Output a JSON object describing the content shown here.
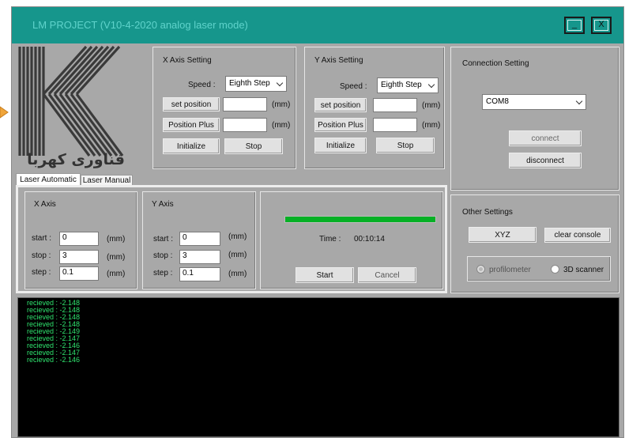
{
  "window": {
    "title": "LM PROJECT (V10-4-2020 analog laser mode)",
    "minimize_label": "_",
    "close_label": "X"
  },
  "logo": {
    "text": "فناوری کهربا",
    "icon": "kahroba-k-logo"
  },
  "x_axis_setting": {
    "title": "X Axis Setting",
    "speed_label": "Speed :",
    "speed_value": "Eighth Step",
    "set_position_label": "set position",
    "set_position_value": "",
    "set_position_unit": "(mm)",
    "position_plus_label": "Position Plus",
    "position_plus_value": "",
    "position_plus_unit": "(mm)",
    "initialize_label": "Initialize",
    "stop_label": "Stop"
  },
  "y_axis_setting": {
    "title": "Y Axis Setting",
    "speed_label": "Speed :",
    "speed_value": "Eighth Step",
    "set_position_label": "set position",
    "set_position_value": "",
    "set_position_unit": "(mm)",
    "position_plus_label": "Position Plus",
    "position_plus_value": "",
    "position_plus_unit": "(mm)",
    "initialize_label": "Initialize",
    "stop_label": "Stop"
  },
  "connection": {
    "title": "Connection Setting",
    "port_value": "COM8",
    "connect_label": "connect",
    "disconnect_label": "disconnect"
  },
  "tabs": {
    "laser_automatic": "Laser Automatic",
    "laser_manual": "Laser Manual"
  },
  "auto_x": {
    "title": "X Axis",
    "start_label": "start :",
    "start_value": "0",
    "start_unit": "(mm)",
    "stop_label": "stop :",
    "stop_value": "3",
    "stop_unit": "(mm)",
    "step_label": "step :",
    "step_value": "0.1",
    "step_unit": "(mm)"
  },
  "auto_y": {
    "title": "Y Axis",
    "start_label": "start :",
    "start_value": "0",
    "start_unit": "(mm)",
    "stop_label": "stop :",
    "stop_value": "3",
    "stop_unit": "(mm)",
    "step_label": "step :",
    "step_value": "0.1",
    "step_unit": "(mm)"
  },
  "progress": {
    "fraction": 1.0,
    "color": "#06b025",
    "time_label": "Time :",
    "time_value": "00:10:14",
    "start_label": "Start",
    "cancel_label": "Cancel"
  },
  "other_settings": {
    "title": "Other Settings",
    "xyz_label": "XYZ",
    "clear_console_label": "clear console",
    "profilometer_label": "profilometer",
    "scanner_label": "3D scanner"
  },
  "console": {
    "lines": [
      "recieved : -2.148",
      "recieved : -2.148",
      "recieved : -2.148",
      "recieved : -2.148",
      "recieved : -2.149",
      "recieved : -2.147",
      "recieved : -2.146",
      "recieved : -2.147",
      "recieved : -2.146"
    ]
  },
  "colors": {
    "titlebar": "#16968c",
    "console_text": "#2fe36e",
    "panel": "#a8a8a8"
  }
}
